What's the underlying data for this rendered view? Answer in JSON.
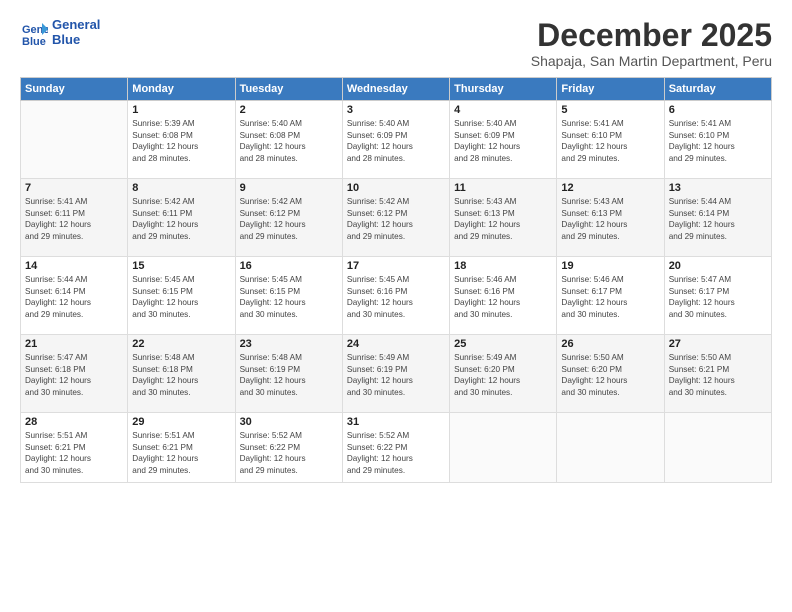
{
  "logo": {
    "line1": "General",
    "line2": "Blue"
  },
  "title": "December 2025",
  "subtitle": "Shapaja, San Martin Department, Peru",
  "days_header": [
    "Sunday",
    "Monday",
    "Tuesday",
    "Wednesday",
    "Thursday",
    "Friday",
    "Saturday"
  ],
  "weeks": [
    [
      {
        "day": "",
        "info": ""
      },
      {
        "day": "1",
        "info": "Sunrise: 5:39 AM\nSunset: 6:08 PM\nDaylight: 12 hours\nand 28 minutes."
      },
      {
        "day": "2",
        "info": "Sunrise: 5:40 AM\nSunset: 6:08 PM\nDaylight: 12 hours\nand 28 minutes."
      },
      {
        "day": "3",
        "info": "Sunrise: 5:40 AM\nSunset: 6:09 PM\nDaylight: 12 hours\nand 28 minutes."
      },
      {
        "day": "4",
        "info": "Sunrise: 5:40 AM\nSunset: 6:09 PM\nDaylight: 12 hours\nand 28 minutes."
      },
      {
        "day": "5",
        "info": "Sunrise: 5:41 AM\nSunset: 6:10 PM\nDaylight: 12 hours\nand 29 minutes."
      },
      {
        "day": "6",
        "info": "Sunrise: 5:41 AM\nSunset: 6:10 PM\nDaylight: 12 hours\nand 29 minutes."
      }
    ],
    [
      {
        "day": "7",
        "info": "Sunrise: 5:41 AM\nSunset: 6:11 PM\nDaylight: 12 hours\nand 29 minutes."
      },
      {
        "day": "8",
        "info": "Sunrise: 5:42 AM\nSunset: 6:11 PM\nDaylight: 12 hours\nand 29 minutes."
      },
      {
        "day": "9",
        "info": "Sunrise: 5:42 AM\nSunset: 6:12 PM\nDaylight: 12 hours\nand 29 minutes."
      },
      {
        "day": "10",
        "info": "Sunrise: 5:42 AM\nSunset: 6:12 PM\nDaylight: 12 hours\nand 29 minutes."
      },
      {
        "day": "11",
        "info": "Sunrise: 5:43 AM\nSunset: 6:13 PM\nDaylight: 12 hours\nand 29 minutes."
      },
      {
        "day": "12",
        "info": "Sunrise: 5:43 AM\nSunset: 6:13 PM\nDaylight: 12 hours\nand 29 minutes."
      },
      {
        "day": "13",
        "info": "Sunrise: 5:44 AM\nSunset: 6:14 PM\nDaylight: 12 hours\nand 29 minutes."
      }
    ],
    [
      {
        "day": "14",
        "info": "Sunrise: 5:44 AM\nSunset: 6:14 PM\nDaylight: 12 hours\nand 29 minutes."
      },
      {
        "day": "15",
        "info": "Sunrise: 5:45 AM\nSunset: 6:15 PM\nDaylight: 12 hours\nand 30 minutes."
      },
      {
        "day": "16",
        "info": "Sunrise: 5:45 AM\nSunset: 6:15 PM\nDaylight: 12 hours\nand 30 minutes."
      },
      {
        "day": "17",
        "info": "Sunrise: 5:45 AM\nSunset: 6:16 PM\nDaylight: 12 hours\nand 30 minutes."
      },
      {
        "day": "18",
        "info": "Sunrise: 5:46 AM\nSunset: 6:16 PM\nDaylight: 12 hours\nand 30 minutes."
      },
      {
        "day": "19",
        "info": "Sunrise: 5:46 AM\nSunset: 6:17 PM\nDaylight: 12 hours\nand 30 minutes."
      },
      {
        "day": "20",
        "info": "Sunrise: 5:47 AM\nSunset: 6:17 PM\nDaylight: 12 hours\nand 30 minutes."
      }
    ],
    [
      {
        "day": "21",
        "info": "Sunrise: 5:47 AM\nSunset: 6:18 PM\nDaylight: 12 hours\nand 30 minutes."
      },
      {
        "day": "22",
        "info": "Sunrise: 5:48 AM\nSunset: 6:18 PM\nDaylight: 12 hours\nand 30 minutes."
      },
      {
        "day": "23",
        "info": "Sunrise: 5:48 AM\nSunset: 6:19 PM\nDaylight: 12 hours\nand 30 minutes."
      },
      {
        "day": "24",
        "info": "Sunrise: 5:49 AM\nSunset: 6:19 PM\nDaylight: 12 hours\nand 30 minutes."
      },
      {
        "day": "25",
        "info": "Sunrise: 5:49 AM\nSunset: 6:20 PM\nDaylight: 12 hours\nand 30 minutes."
      },
      {
        "day": "26",
        "info": "Sunrise: 5:50 AM\nSunset: 6:20 PM\nDaylight: 12 hours\nand 30 minutes."
      },
      {
        "day": "27",
        "info": "Sunrise: 5:50 AM\nSunset: 6:21 PM\nDaylight: 12 hours\nand 30 minutes."
      }
    ],
    [
      {
        "day": "28",
        "info": "Sunrise: 5:51 AM\nSunset: 6:21 PM\nDaylight: 12 hours\nand 30 minutes."
      },
      {
        "day": "29",
        "info": "Sunrise: 5:51 AM\nSunset: 6:21 PM\nDaylight: 12 hours\nand 29 minutes."
      },
      {
        "day": "30",
        "info": "Sunrise: 5:52 AM\nSunset: 6:22 PM\nDaylight: 12 hours\nand 29 minutes."
      },
      {
        "day": "31",
        "info": "Sunrise: 5:52 AM\nSunset: 6:22 PM\nDaylight: 12 hours\nand 29 minutes."
      },
      {
        "day": "",
        "info": ""
      },
      {
        "day": "",
        "info": ""
      },
      {
        "day": "",
        "info": ""
      }
    ]
  ]
}
